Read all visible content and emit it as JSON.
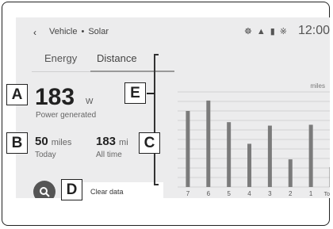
{
  "status_bar": {
    "back_icon": "chevron-left-icon",
    "breadcrumb_parent": "Vehicle",
    "breadcrumb_separator": "•",
    "breadcrumb_current": "Solar",
    "icons": [
      "steering-wheel-icon",
      "passenger-icon",
      "signal-bars-icon",
      "bluetooth-icon"
    ],
    "time": "12:00"
  },
  "tabs": [
    {
      "label": "Energy",
      "selected": false
    },
    {
      "label": "Distance",
      "selected": true
    }
  ],
  "power": {
    "value": "183",
    "unit": "W",
    "label": "Power generated"
  },
  "today": {
    "value": "50",
    "unit": "miles",
    "label": "Today"
  },
  "all_time": {
    "value": "183",
    "unit": "mi",
    "label": "All time"
  },
  "actions": {
    "search_icon": "search-icon",
    "clear_label": "Clear data"
  },
  "callouts": {
    "a": "A",
    "b": "B",
    "c": "C",
    "d": "D",
    "e": "E"
  },
  "chart_data": {
    "type": "bar",
    "ylabel": "miles",
    "categories": [
      "7",
      "6",
      "5",
      "4",
      "3",
      "2",
      "1",
      "Today"
    ],
    "values": [
      88,
      100,
      75,
      50,
      71,
      32,
      72,
      23
    ],
    "ylim": [
      0,
      110
    ],
    "grid": true,
    "bar_color": "#7b7b7b"
  }
}
